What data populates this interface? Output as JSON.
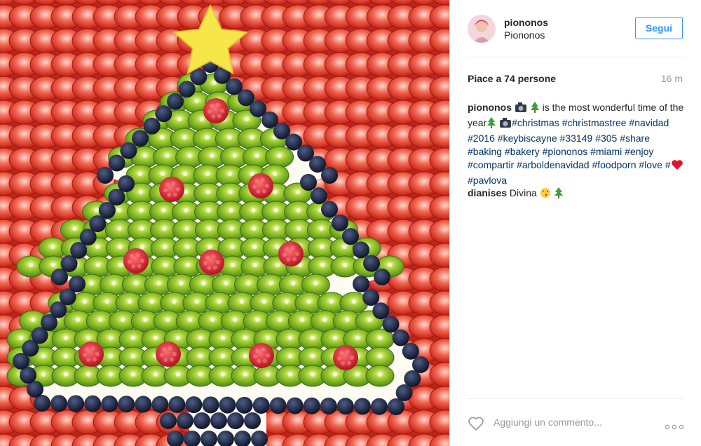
{
  "post": {
    "username": "piononos",
    "location": "Piononos",
    "follow_label": "Segui",
    "likes_text": "Piace a 74 persone",
    "time_ago": "16 m",
    "caption": {
      "author": "piononos",
      "text_before_emoji": "is the most wonderful time of the year",
      "hashtags_line": [
        "#christmas",
        "#christmastree",
        "#navidad",
        "#2016",
        "#keybiscayne",
        "#33149",
        "#305",
        "#share",
        "#baking",
        "#bakery",
        "#piononos",
        "#miami",
        "#enjoy",
        "#compartir",
        "#arboldenavidad",
        "#foodporn",
        "#love",
        "#"
      ],
      "last_tag": "#pavlova"
    },
    "comments": [
      {
        "author": "dianises",
        "text": "Divina"
      }
    ],
    "add_comment_placeholder": "Aggiungi un commento...",
    "more_icon": "ellipsis-icon",
    "like_icon": "heart-outline-icon"
  },
  "colors": {
    "accent": "#3897f0",
    "hashtag": "#003569",
    "muted": "#999999",
    "text": "#262626"
  }
}
